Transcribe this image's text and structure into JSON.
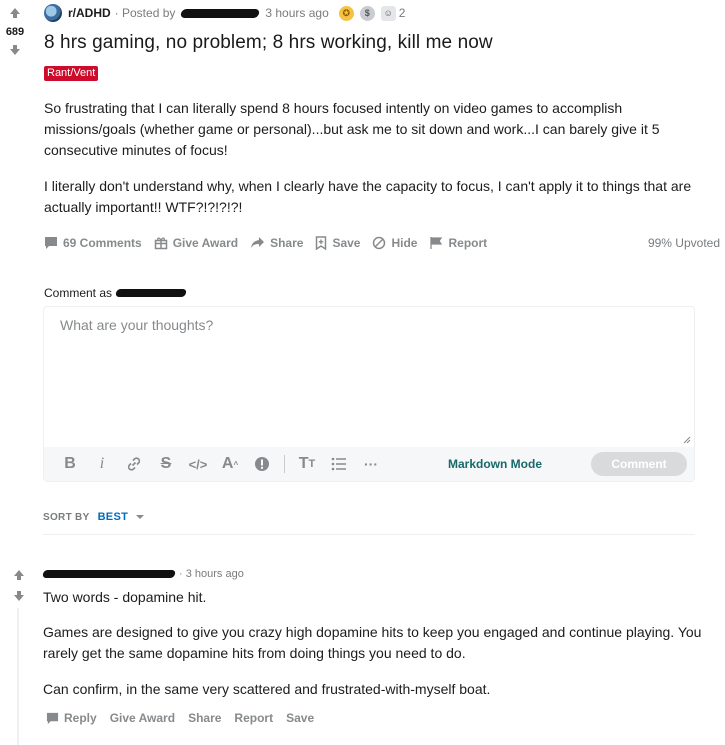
{
  "post": {
    "vote_count": "689",
    "subreddit": "r/ADHD",
    "posted_by_prefix": "· Posted by",
    "time": "3 hours ago",
    "award_count": "2",
    "title": "8 hrs gaming, no problem; 8 hrs working, kill me now",
    "flair": "Rant/Vent",
    "paragraphs": [
      "So frustrating that I can literally spend 8 hours focused intently on video games to accomplish missions/goals (whether game or personal)...but ask me to sit down and work...I can barely give it 5 consecutive minutes of focus!",
      "I literally don't understand why, when I clearly have the capacity to focus, I can't apply it to things that are actually important!! WTF?!?!?!?!"
    ],
    "actions": {
      "comments": "69 Comments",
      "give_award": "Give Award",
      "share": "Share",
      "save": "Save",
      "hide": "Hide",
      "report": "Report"
    },
    "upvoted": "99% Upvoted"
  },
  "composer": {
    "comment_as": "Comment as",
    "placeholder": "What are your thoughts?",
    "markdown_mode": "Markdown Mode",
    "submit": "Comment"
  },
  "sort": {
    "label": "SORT BY",
    "value": "BEST"
  },
  "comment": {
    "time": "· 3 hours ago",
    "paragraphs": [
      "Two words - dopamine hit.",
      "Games are designed to give you crazy high dopamine hits to keep you engaged and continue playing. You rarely get the same dopamine hits from doing things you need to do.",
      "Can confirm, in the same very scattered and frustrated-with-myself boat."
    ],
    "actions": {
      "reply": "Reply",
      "give_award": "Give Award",
      "share": "Share",
      "report": "Report",
      "save": "Save"
    }
  },
  "colors": {
    "flair_bg": "#cc0c2a",
    "muted": "#878a8c",
    "link_blue": "#006cbd",
    "markdown_teal": "#17696a"
  }
}
